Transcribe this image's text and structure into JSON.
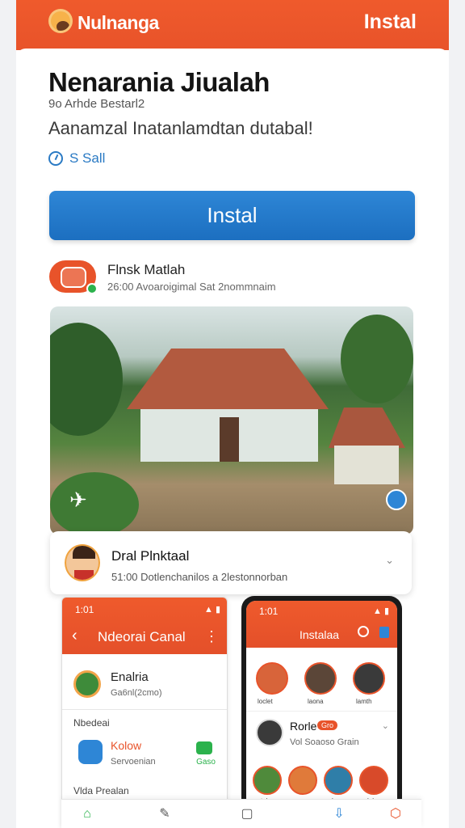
{
  "header": {
    "app_name": "Nulnanga",
    "install_label": "Instal"
  },
  "listing": {
    "title": "Nenarania Jiualah",
    "subline": "9o Arhde Bestarl2",
    "description": "Aanamzal Inatanlamdtan dutabal!",
    "meta": "S Sall",
    "install_label": "Instal"
  },
  "developer": {
    "name": "Flnsk Matlah",
    "sub": "26:00 Avoaroigimal Sat 2nommnaim"
  },
  "comment": {
    "name": "Dral Plnktaal",
    "sub": "51:00 Dotlenchanilos a 2lestonnorban"
  },
  "phone_left": {
    "time": "1:01",
    "status": "▲ ▮",
    "title": "Ndeorai Canal",
    "row1_name": "Enalria",
    "row1_sub": "Ga6nl(2cmo)",
    "section": "Nbedeai",
    "row2_name": "Kolow",
    "row2_sub": "Servoenian",
    "chat_label": "Gaso",
    "bottom_label": "Vlda Prealan"
  },
  "phone_right": {
    "time": "1:01",
    "status": "▲ ▮",
    "title": "Instalaa",
    "stories": [
      "loclet",
      "laona",
      "lamth"
    ],
    "row_name": "Rorle",
    "row_badge": "Gro",
    "row_sub": "Vol Soaoso Grain",
    "stories2": [
      "tals",
      "",
      "lan",
      "lale"
    ]
  },
  "nav": {
    "icons": [
      "home-icon",
      "pen-icon",
      "chat-icon",
      "download-icon",
      "hexagon-icon"
    ]
  },
  "colors": {
    "brand_orange": "#e8532a",
    "brand_blue": "#2e86d6",
    "accent_green": "#2bb24c"
  }
}
